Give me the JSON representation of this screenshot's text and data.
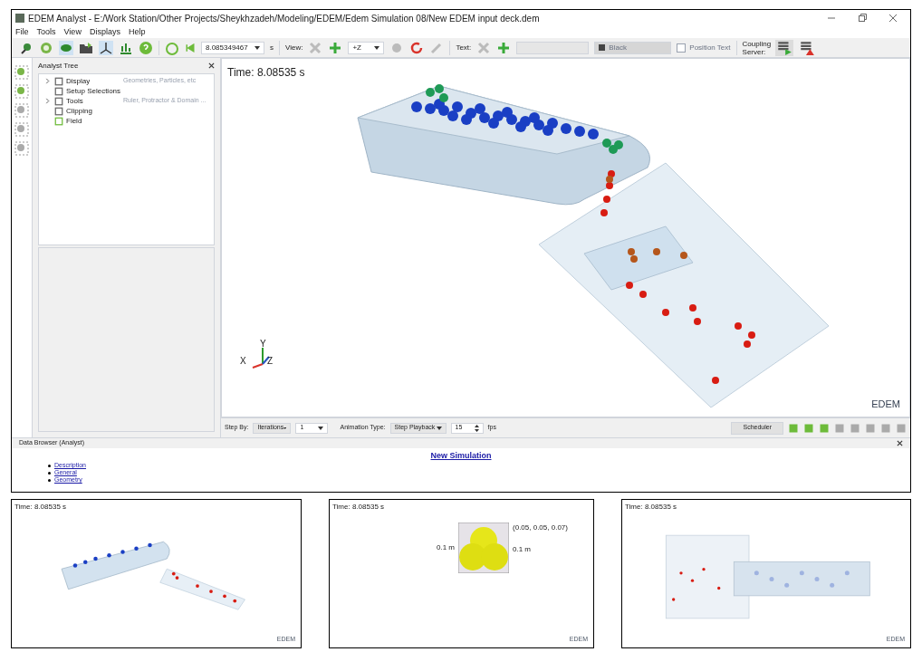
{
  "window": {
    "title": "EDEM Analyst - E:/Work Station/Other Projects/Sheykhzadeh/Modeling/EDEM/Edem Simulation 08/New EDEM input deck.dem"
  },
  "menu": [
    "File",
    "Tools",
    "View",
    "Displays",
    "Help"
  ],
  "toolbar": {
    "time_value": "8.085349467",
    "time_unit": "s",
    "view_label": "View:",
    "view_axis": "+Z",
    "text_label": "Text:",
    "text_color": "Black",
    "position_text": {
      "label": "Position Text",
      "checked": false
    },
    "coupling_label": "Coupling Server:"
  },
  "analyst_tree": {
    "title": "Analyst Tree",
    "items": [
      {
        "label": "Display",
        "hint": "Geometries, Particles, etc",
        "expandable": true
      },
      {
        "label": "Setup Selections",
        "expandable": false
      },
      {
        "label": "Tools",
        "hint": "Ruler, Protractor & Domain ...",
        "expandable": true
      },
      {
        "label": "Clipping",
        "expandable": false
      },
      {
        "label": "Field",
        "expandable": false
      }
    ]
  },
  "viewport": {
    "time": "Time: 8.08535 s",
    "axes": [
      "X",
      "Y",
      "Z"
    ],
    "logo": "EDEM"
  },
  "playback": {
    "step_by_label": "Step By:",
    "step_by": "Iterations",
    "step": "1",
    "animation_label": "Animation Type:",
    "animation": "Step Playback",
    "fps": "15",
    "fps_unit": "fps",
    "scheduler": "Scheduler"
  },
  "data_browser": {
    "title": "Data Browser (Analyst)",
    "heading": "New Simulation",
    "links": [
      "Description",
      "General",
      "Geometry"
    ]
  },
  "previews": [
    {
      "kind": "scene",
      "time": "Time: 8.08535 s",
      "logo": "EDEM"
    },
    {
      "kind": "particle",
      "time": "Time: 8.08535 s",
      "corner": "(0.05, 0.05, 0.07)",
      "dims": [
        "0.1 m",
        "0.1 m"
      ],
      "logo": "EDEM"
    },
    {
      "kind": "top",
      "time": "Time: 8.08535 s",
      "logo": "EDEM"
    }
  ]
}
